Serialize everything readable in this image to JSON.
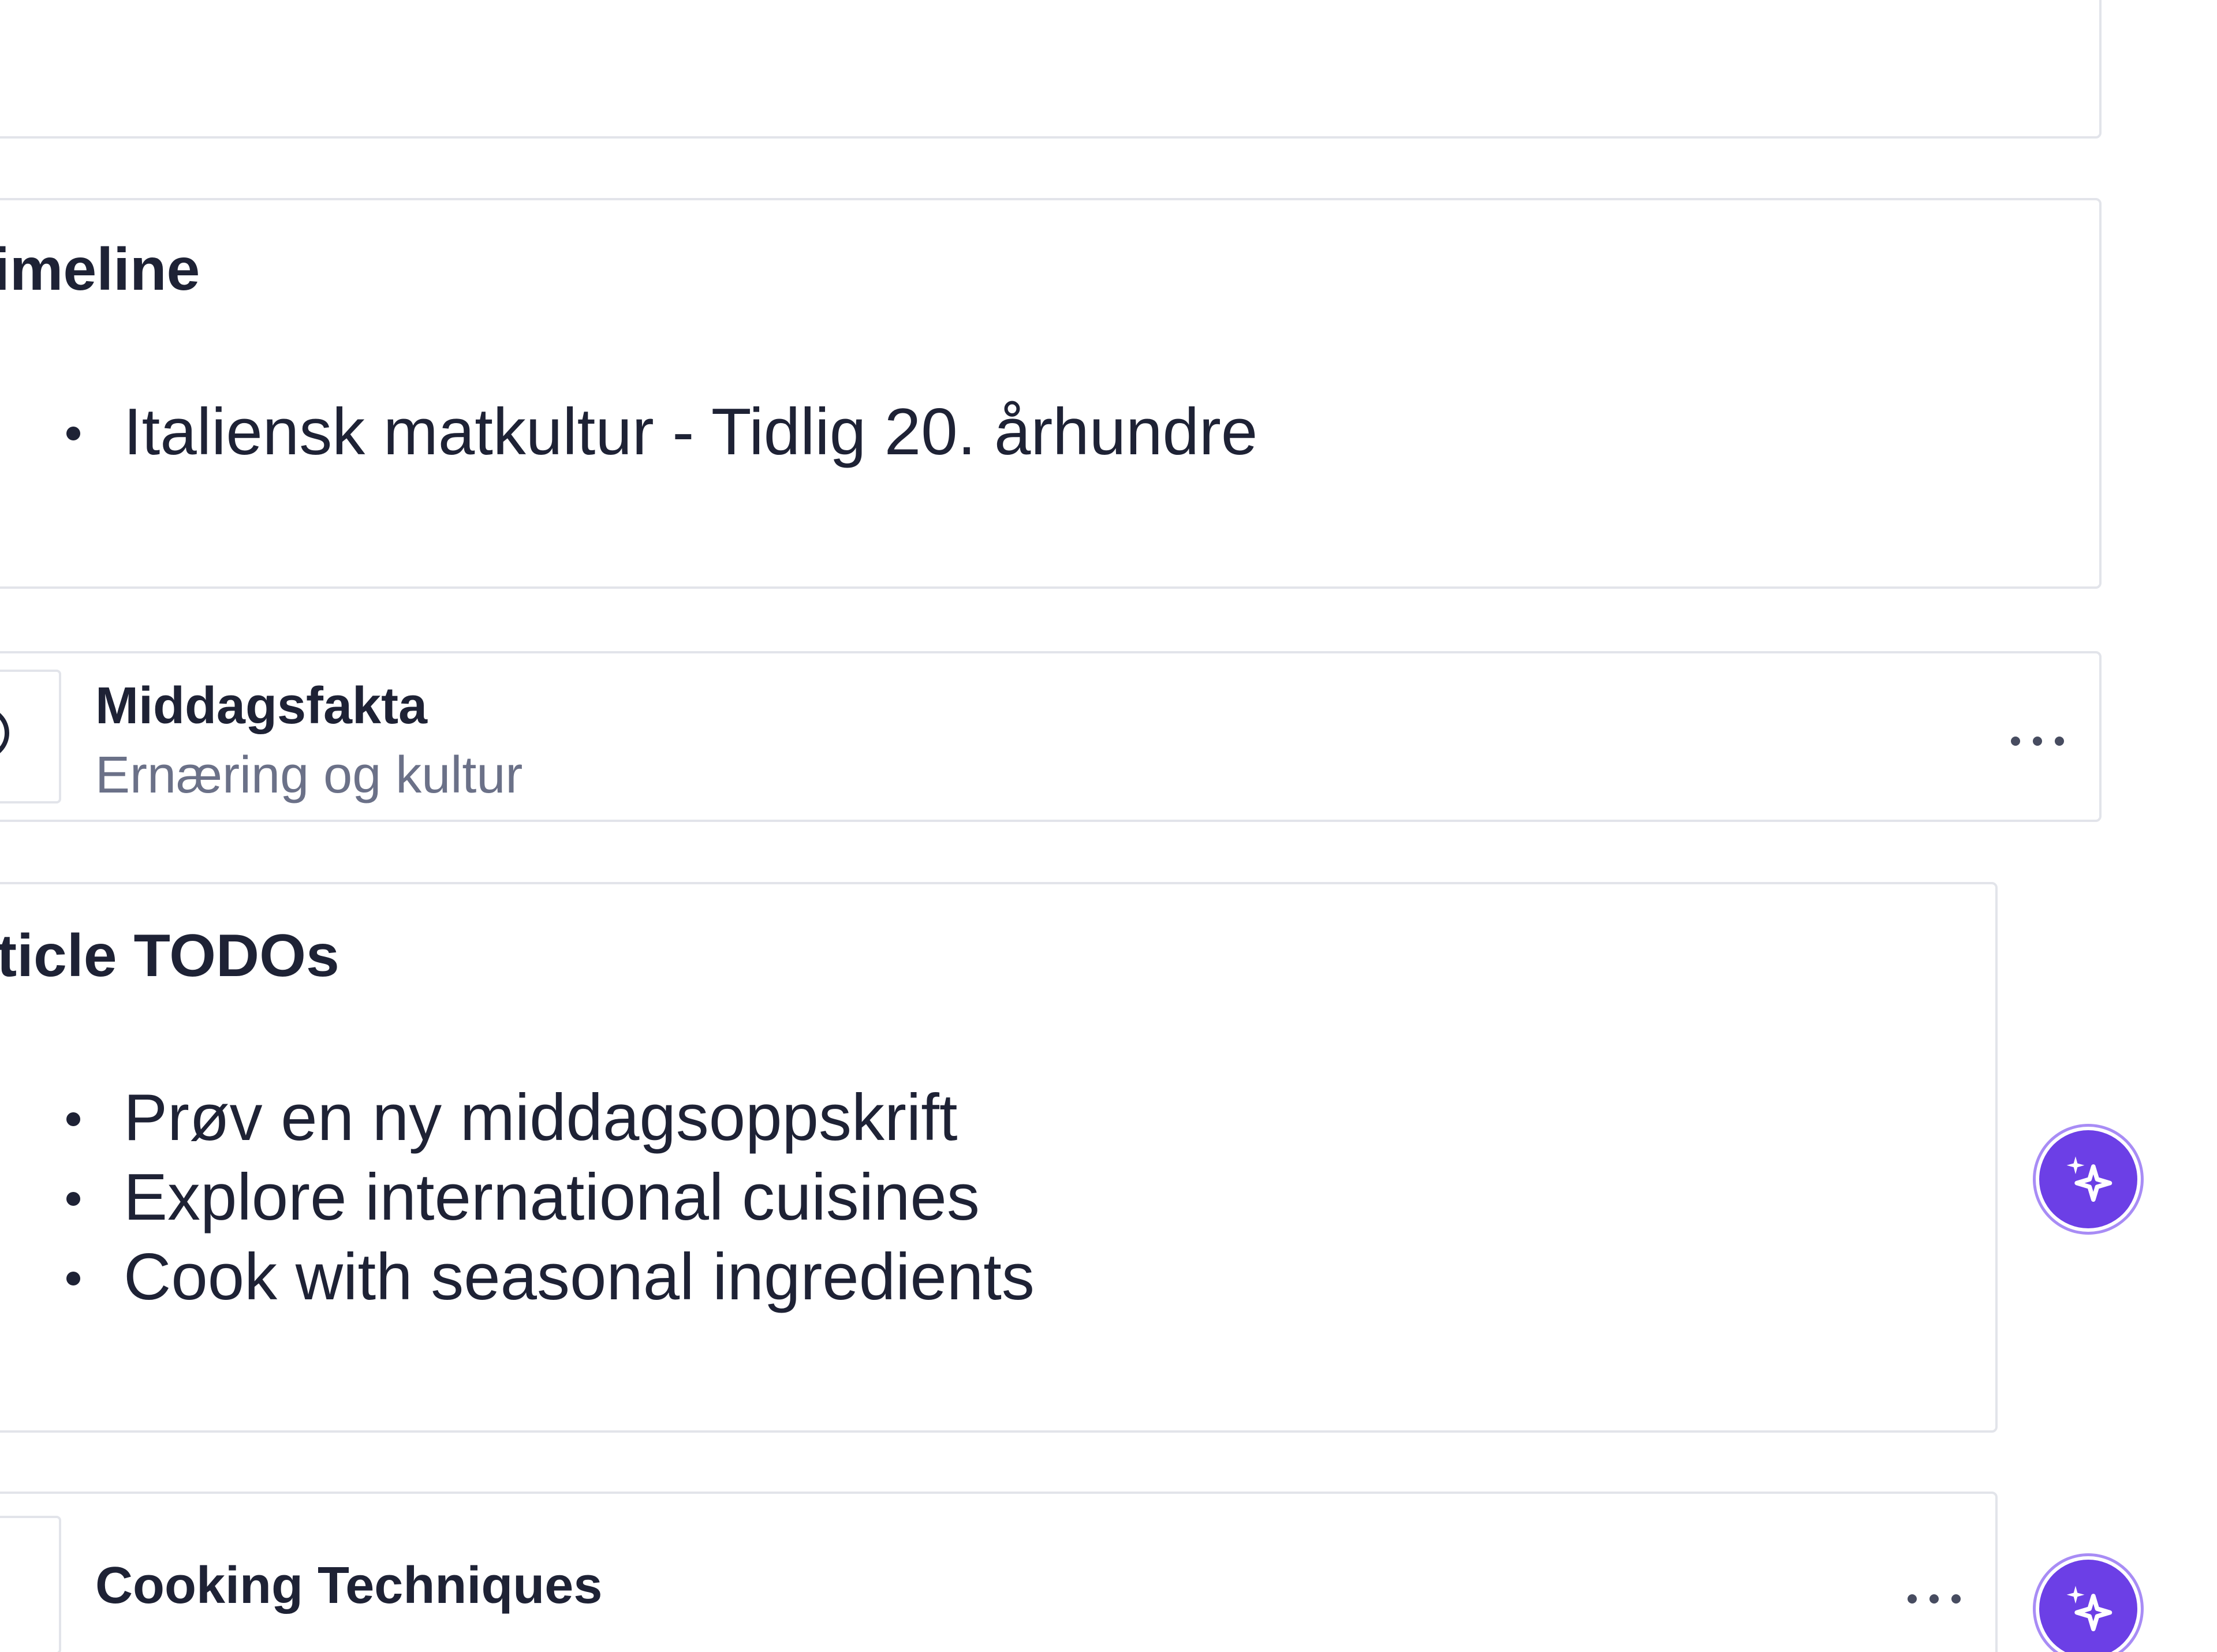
{
  "timeline": {
    "heading": "imeline",
    "items": [
      "Italiensk matkultur - Tidlig 20. århundre"
    ]
  },
  "fact_item": {
    "title": "Middagsfakta",
    "subtitle": "Ernæring og kultur"
  },
  "todos": {
    "heading": "rticle TODOs",
    "items": [
      "Prøv en ny middagsoppskrift",
      "Explore international cuisines",
      "Cook with seasonal ingredients"
    ]
  },
  "technique_item": {
    "title": "Cooking Techniques"
  },
  "icons": {
    "more": "more-horizontal-icon",
    "ai": "sparkles-icon"
  },
  "colors": {
    "accent": "#6c3fe6",
    "text": "#1e2235",
    "muted": "#6b7188",
    "border": "#e2e4ea"
  }
}
